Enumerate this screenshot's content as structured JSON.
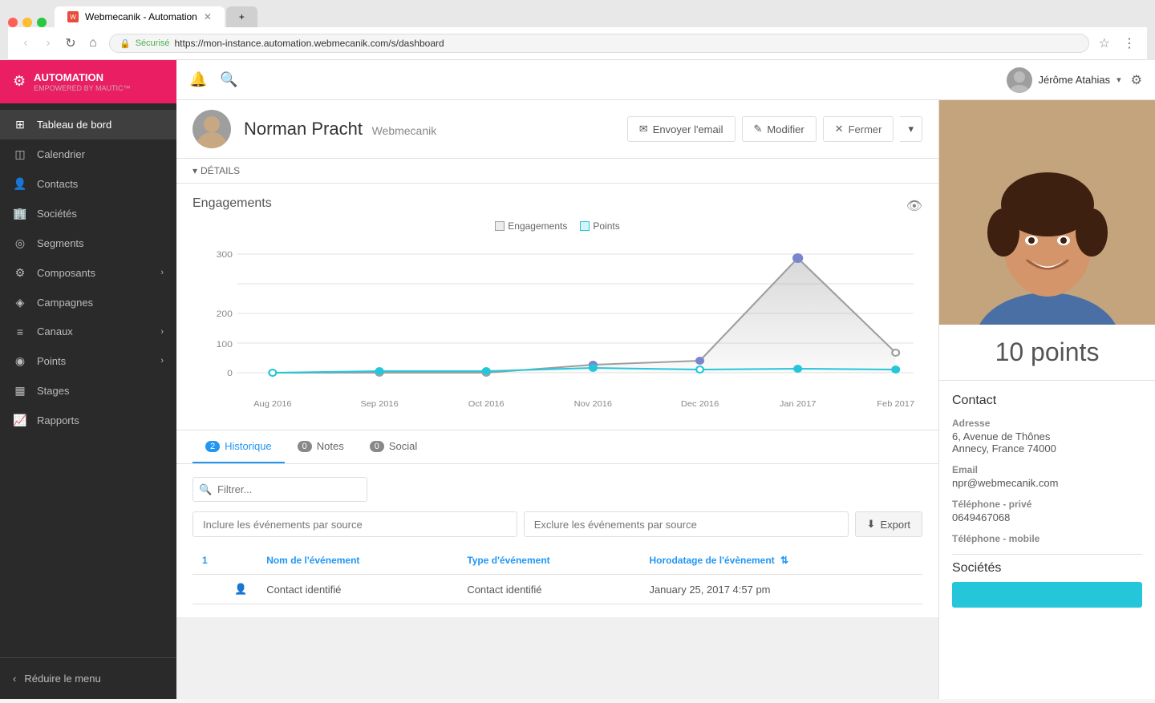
{
  "browser": {
    "tab_title": "Webmecanik - Automation",
    "tab_inactive_label": "",
    "url_secure": "Sécurisé",
    "url": "https://mon-instance.automation.webmecanik.com/s/dashboard",
    "traffic_lights": [
      "red",
      "yellow",
      "green"
    ]
  },
  "header": {
    "username": "Jérôme Atahias",
    "dropdown_icon": "▾",
    "bell_icon": "🔔",
    "search_icon": "🔍",
    "gear_icon": "⚙"
  },
  "sidebar": {
    "logo_text": "AUTOMATION",
    "logo_sub": "EMPOWERED BY MAUTIC™",
    "items": [
      {
        "label": "Tableau de bord",
        "icon": "⊞",
        "active": true,
        "has_arrow": false
      },
      {
        "label": "Calendrier",
        "icon": "📅",
        "active": false,
        "has_arrow": false
      },
      {
        "label": "Contacts",
        "icon": "👤",
        "active": false,
        "has_arrow": false
      },
      {
        "label": "Sociétés",
        "icon": "🏢",
        "active": false,
        "has_arrow": false
      },
      {
        "label": "Segments",
        "icon": "◎",
        "active": false,
        "has_arrow": false
      },
      {
        "label": "Composants",
        "icon": "⚙",
        "active": false,
        "has_arrow": true
      },
      {
        "label": "Campagnes",
        "icon": "◈",
        "active": false,
        "has_arrow": false
      },
      {
        "label": "Canaux",
        "icon": "≡",
        "active": false,
        "has_arrow": true
      },
      {
        "label": "Points",
        "icon": "◉",
        "active": false,
        "has_arrow": true
      },
      {
        "label": "Stages",
        "icon": "📊",
        "active": false,
        "has_arrow": false
      },
      {
        "label": "Rapports",
        "icon": "📈",
        "active": false,
        "has_arrow": false
      }
    ],
    "collapse_label": "Réduire le menu",
    "collapse_icon": "‹"
  },
  "contact": {
    "name": "Norman Pracht",
    "company": "Webmecanik",
    "actions": {
      "send_email": "Envoyer l'email",
      "edit": "Modifier",
      "close": "Fermer"
    }
  },
  "details": {
    "toggle_label": "DÉTAILS",
    "toggle_icon": "▾"
  },
  "chart": {
    "title": "Engagements",
    "legend": [
      {
        "label": "Engagements",
        "color": "#9e9e9e"
      },
      {
        "label": "Points",
        "color": "#26c6da"
      }
    ],
    "x_labels": [
      "Aug 2016",
      "Sep 2016",
      "Oct 2016",
      "Nov 2016",
      "Dec 2016",
      "Jan 2017",
      "Feb 2017"
    ],
    "y_labels": [
      "300",
      "200",
      "100",
      "0"
    ],
    "engagements_data": [
      0,
      0,
      0,
      20,
      30,
      290,
      50
    ],
    "points_data": [
      0,
      4,
      4,
      12,
      8,
      10,
      8
    ]
  },
  "tabs": [
    {
      "label": "Historique",
      "badge": "2",
      "active": true
    },
    {
      "label": "Notes",
      "badge": "0",
      "active": false
    },
    {
      "label": "Social",
      "badge": "0",
      "active": false
    }
  ],
  "history": {
    "filter_placeholder": "Filtrer...",
    "include_placeholder": "Inclure les événements par source",
    "exclude_placeholder": "Exclure les événements par source",
    "export_label": "Export",
    "table": {
      "columns": [
        "Nom de l'événement",
        "Type d'événement",
        "Horodatage de l'évènement"
      ],
      "rows": [
        {
          "num": "1",
          "icon": "👤",
          "event_name": "Contact identifié",
          "event_type": "Contact identifié",
          "timestamp": "January 25, 2017 4:57 pm"
        }
      ]
    }
  },
  "right_panel": {
    "points": "10 points",
    "contact_section": "Contact",
    "address_label": "Adresse",
    "address_value": "6, Avenue de Thônes\nAnnecy, France 74000",
    "email_label": "Email",
    "email_value": "npr@webmecanik.com",
    "phone_private_label": "Téléphone - privé",
    "phone_private_value": "0649467068",
    "phone_mobile_label": "Téléphone - mobile",
    "phone_mobile_value": "",
    "societies_label": "Sociétés"
  }
}
